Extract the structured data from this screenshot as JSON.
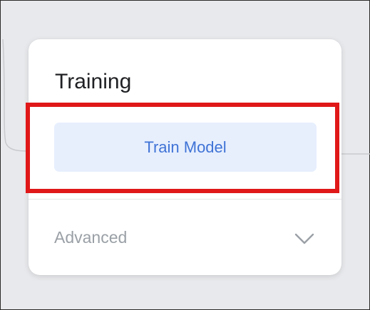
{
  "card": {
    "title": "Training",
    "train_button_label": "Train Model",
    "advanced_label": "Advanced"
  },
  "icons": {
    "expand": "chevron-down-icon"
  },
  "colors": {
    "highlight": "#e01818",
    "button_bg": "#e7effd",
    "button_text": "#3f73d6",
    "canvas_bg": "#e8e9ec"
  }
}
